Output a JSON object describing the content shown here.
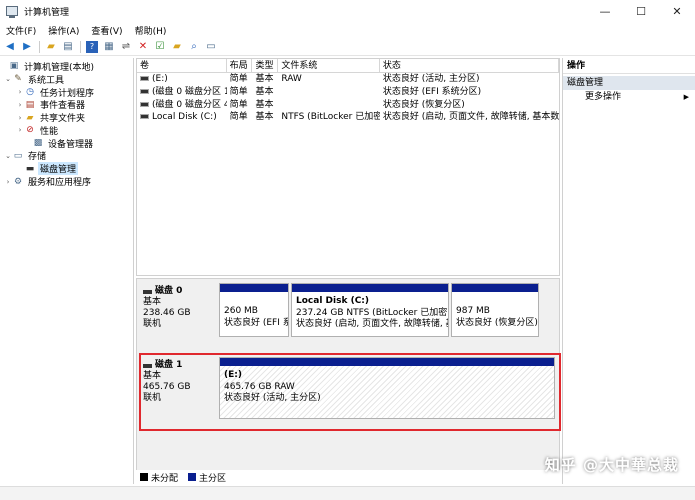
{
  "window": {
    "title": "计算机管理",
    "icons": {
      "app": "computer-management-icon",
      "minimize": "minimize-icon",
      "maximize": "maximize-icon",
      "close": "close-icon"
    }
  },
  "menu": [
    "文件(F)",
    "操作(A)",
    "查看(V)",
    "帮助(H)"
  ],
  "toolbar": [
    "back-icon",
    "forward-icon",
    "up-folder-icon",
    "show-hide-console-tree-icon",
    "help-icon",
    "properties-icon",
    "connect-drive-icon",
    "delete-icon",
    "check-icon",
    "new-folder-icon",
    "search-icon",
    "list-view-icon"
  ],
  "tree": {
    "root": "计算机管理(本地)",
    "system_tools": "系统工具",
    "task_scheduler": "任务计划程序",
    "event_viewer": "事件查看器",
    "shared_folders": "共享文件夹",
    "performance": "性能",
    "device_manager": "设备管理器",
    "storage": "存储",
    "disk_management": "磁盘管理",
    "services": "服务和应用程序"
  },
  "volumes": {
    "headers": [
      "卷",
      "布局",
      "类型",
      "文件系统",
      "状态"
    ],
    "rows": [
      [
        "(E:)",
        "简单",
        "基本",
        "RAW",
        "状态良好 (活动, 主分区)"
      ],
      [
        "(磁盘 0 磁盘分区 1)",
        "简单",
        "基本",
        "",
        "状态良好 (EFI 系统分区)"
      ],
      [
        "(磁盘 0 磁盘分区 4)",
        "简单",
        "基本",
        "",
        "状态良好 (恢复分区)"
      ],
      [
        "Local Disk (C:)",
        "简单",
        "基本",
        "NTFS (BitLocker 已加密)",
        "状态良好 (启动, 页面文件, 故障转储, 基本数据分"
      ]
    ]
  },
  "disks": [
    {
      "name": "磁盘 0",
      "type": "基本",
      "size": "238.46 GB",
      "status": "联机",
      "partitions": [
        {
          "name": "",
          "line1": "260 MB",
          "line2": "状态良好 (EFI 系"
        },
        {
          "name": "Local Disk  (C:)",
          "line1": "237.24 GB NTFS (BitLocker 已加密)",
          "line2": "状态良好 (启动, 页面文件, 故障转储, 基本"
        },
        {
          "name": "",
          "line1": "987 MB",
          "line2": "状态良好 (恢复分区)"
        }
      ]
    },
    {
      "name": "磁盘 1",
      "type": "基本",
      "size": "465.76 GB",
      "status": "联机",
      "partitions": [
        {
          "name": "(E:)",
          "line1": "465.76 GB RAW",
          "line2": "状态良好 (活动, 主分区)"
        }
      ]
    }
  ],
  "legend": [
    {
      "label": "未分配",
      "color": "#000000"
    },
    {
      "label": "主分区",
      "color": "#0a1f8f"
    }
  ],
  "actions": {
    "header": "操作",
    "section": "磁盘管理",
    "more": "更多操作"
  },
  "watermark": "知乎 @大中華总裁",
  "colors": {
    "partition_bar": "#0a1f8f",
    "highlight": "#e0282e",
    "selected": "#cce8ff",
    "action_section": "#dfe6ee"
  }
}
